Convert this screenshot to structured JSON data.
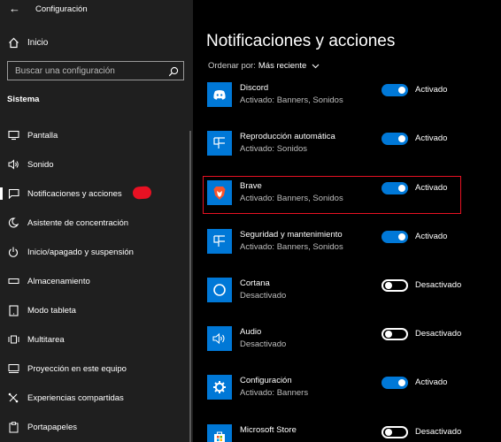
{
  "window": {
    "title": "Configuración"
  },
  "sidebar": {
    "home_label": "Inicio",
    "search_placeholder": "Buscar una configuración",
    "section": "Sistema",
    "items": [
      {
        "label": "Pantalla",
        "icon": "monitor-icon"
      },
      {
        "label": "Sonido",
        "icon": "speaker-icon"
      },
      {
        "label": "Notificaciones y acciones",
        "icon": "message-icon"
      },
      {
        "label": "Asistente de concentración",
        "icon": "moon-icon"
      },
      {
        "label": "Inicio/apagado y suspensión",
        "icon": "power-icon"
      },
      {
        "label": "Almacenamiento",
        "icon": "storage-icon"
      },
      {
        "label": "Modo tableta",
        "icon": "tablet-icon"
      },
      {
        "label": "Multitarea",
        "icon": "multitask-icon"
      },
      {
        "label": "Proyección en este equipo",
        "icon": "projection-icon"
      },
      {
        "label": "Experiencias compartidas",
        "icon": "share-icon"
      },
      {
        "label": "Portapapeles",
        "icon": "clipboard-icon"
      }
    ]
  },
  "main": {
    "title": "Notificaciones y acciones",
    "sort_label": "Ordenar por:",
    "sort_value": "Más reciente",
    "apps": [
      {
        "name": "Discord",
        "sub": "Activado: Banners, Sonidos",
        "state": "Activado",
        "on": true,
        "icon": "discord-icon"
      },
      {
        "name": "Reproducción automática",
        "sub": "Activado: Sonidos",
        "state": "Activado",
        "on": true,
        "icon": "autoplay-icon"
      },
      {
        "name": "Brave",
        "sub": "Activado: Banners, Sonidos",
        "state": "Activado",
        "on": true,
        "icon": "brave-icon"
      },
      {
        "name": "Seguridad y mantenimiento",
        "sub": "Activado: Banners, Sonidos",
        "state": "Activado",
        "on": true,
        "icon": "security-icon"
      },
      {
        "name": "Cortana",
        "sub": "Desactivado",
        "state": "Desactivado",
        "on": false,
        "icon": "cortana-icon"
      },
      {
        "name": "Audio",
        "sub": "Desactivado",
        "state": "Desactivado",
        "on": false,
        "icon": "audio-icon"
      },
      {
        "name": "Configuración",
        "sub": "Activado: Banners",
        "state": "Activado",
        "on": true,
        "icon": "settings-gear-icon"
      },
      {
        "name": "Microsoft Store",
        "sub": "",
        "state": "Desactivado",
        "on": false,
        "icon": "store-icon"
      }
    ]
  },
  "colors": {
    "accent": "#0078d7",
    "highlight": "#e81123",
    "sidebar_bg": "#1f1f1f",
    "main_bg": "#000000"
  }
}
